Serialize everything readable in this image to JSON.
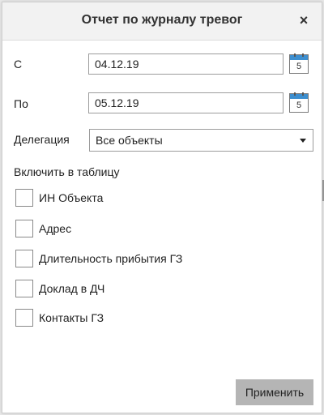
{
  "dialog": {
    "title": "Отчет по журналу тревог",
    "close_glyph": "×"
  },
  "form": {
    "from_label": "С",
    "from_value": "04.12.19",
    "to_label": "По",
    "to_value": "05.12.19",
    "calendar_icon_number": "5",
    "delegation_label": "Делегация",
    "delegation_value": "Все объекты",
    "include_label": "Включить в таблицу"
  },
  "checkboxes": [
    {
      "label": "ИН Объекта",
      "checked": false
    },
    {
      "label": "Адрес",
      "checked": false
    },
    {
      "label": "Длительность прибытия ГЗ",
      "checked": false
    },
    {
      "label": "Доклад в ДЧ",
      "checked": false
    },
    {
      "label": "Контакты ГЗ",
      "checked": false
    }
  ],
  "footer": {
    "apply_label": "Применить"
  },
  "colors": {
    "header_bg": "#f2f2f2",
    "button_bg": "#b5b5b5",
    "calendar_accent": "#3d8fd0"
  }
}
